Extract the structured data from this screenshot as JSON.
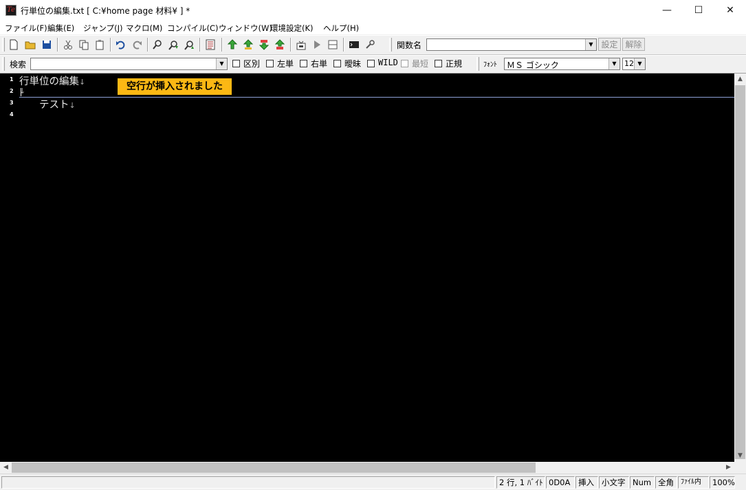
{
  "window": {
    "title": "行単位の編集.txt [ C:¥home page 材料¥ ] *",
    "minimize": "—",
    "maximize": "☐",
    "close": "✕"
  },
  "menu": [
    "ファイル(F)",
    "編集(E)",
    "ジャンプ(J)",
    "マクロ(M)",
    "コンパイル(C)",
    "ウィンドウ(W)",
    "環境設定(K)",
    "ヘルプ(H)"
  ],
  "toolbar": {
    "function_label": "関数名",
    "function_value": "",
    "set_button": "設定",
    "clear_button": "解除",
    "icons": [
      "new-file",
      "open-folder",
      "save",
      "cut",
      "copy",
      "paste",
      "undo",
      "redo",
      "find",
      "find-next",
      "find-prev",
      "grep",
      "bookmark-up",
      "bookmark-down",
      "line-insert",
      "line-delete",
      "compile",
      "run",
      "split",
      "console",
      "tool"
    ]
  },
  "search": {
    "label": "検索",
    "value": "",
    "options": [
      {
        "label": "区別",
        "checked": false,
        "enabled": true
      },
      {
        "label": "左単",
        "checked": false,
        "enabled": true
      },
      {
        "label": "右単",
        "checked": false,
        "enabled": true
      },
      {
        "label": "曖昧",
        "checked": false,
        "enabled": true
      },
      {
        "label": "WILD",
        "checked": false,
        "enabled": true
      },
      {
        "label": "最短",
        "checked": false,
        "enabled": false
      },
      {
        "label": "正規",
        "checked": false,
        "enabled": true
      }
    ],
    "font_label": "ﾌｫﾝﾄ",
    "font_value": "ＭＳ ゴシック",
    "size_value": "12"
  },
  "editor": {
    "line_numbers": [
      "1",
      "2",
      "3",
      "4"
    ],
    "lines": [
      "行単位の編集",
      "",
      "　　テスト",
      ""
    ],
    "eol_mark": "↓",
    "notification": "空行が挿入されました"
  },
  "status": {
    "position": "2 行, 1 ﾊﾞｲﾄ",
    "newline": "0D0A",
    "mode": "挿入",
    "case": "小文字",
    "num": "Num",
    "width": "全角",
    "scope": "ﾌｧｲﾙ内",
    "zoom": "100%"
  },
  "colors": {
    "editor_bg": "#000000",
    "editor_text": "#e8e8e8",
    "notification_bg": "#fcb814"
  }
}
